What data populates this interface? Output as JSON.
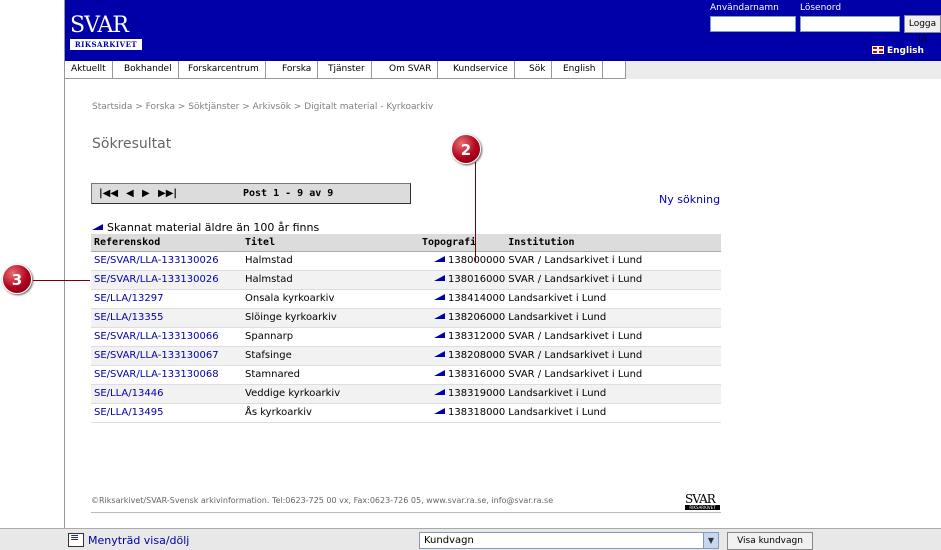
{
  "header": {
    "logo_text": "SVAR",
    "logo_sub": "RIKSARKIVET",
    "username_label": "Användarnamn",
    "password_label": "Lösenord",
    "username_value": "",
    "password_value": "",
    "login_button": "Logga in",
    "english_link": "English",
    "brand_color": "#0000a8"
  },
  "nav": {
    "items": [
      {
        "label": "Aktuellt"
      },
      {
        "label": "Bokhandel"
      },
      {
        "label": "Forskarcentrum"
      },
      {
        "label": "Forska"
      },
      {
        "label": "Tjänster"
      },
      {
        "label": "Om SVAR"
      },
      {
        "label": "Kundservice"
      },
      {
        "label": "Sök"
      },
      {
        "label": "English"
      }
    ]
  },
  "breadcrumb": "Startsida > Forska > Söktjänster > Arkivsök > Digitalt material - Kyrkoarkiv",
  "page_title": "Sökresultat",
  "pager": {
    "first_icon": "first-page-icon",
    "prev_icon": "prev-page-icon",
    "next_icon": "next-page-icon",
    "last_icon": "last-page-icon",
    "status": "Post 1 - 9 av 9"
  },
  "new_search": "Ny sökning",
  "legend": "Skannat material äldre än 100 år finns",
  "table": {
    "headers": [
      "Referenskod",
      "Titel",
      "Topografi",
      "Institution"
    ],
    "rows": [
      {
        "ref": "SE/SVAR/LLA-133130026",
        "title": "Halmstad",
        "topo": "138000000",
        "inst": "SVAR / Landsarkivet i Lund"
      },
      {
        "ref": "SE/SVAR/LLA-133130026",
        "title": "Halmstad",
        "topo": "138016000",
        "inst": "SVAR / Landsarkivet i Lund"
      },
      {
        "ref": "SE/LLA/13297",
        "title": "Onsala kyrkoarkiv",
        "topo": "138414000",
        "inst": "Landsarkivet i Lund"
      },
      {
        "ref": "SE/LLA/13355",
        "title": "Slöinge kyrkoarkiv",
        "topo": "138206000",
        "inst": "Landsarkivet i Lund"
      },
      {
        "ref": "SE/SVAR/LLA-133130066",
        "title": "Spannarp",
        "topo": "138312000",
        "inst": "SVAR / Landsarkivet i Lund"
      },
      {
        "ref": "SE/SVAR/LLA-133130067",
        "title": "Stafsinge",
        "topo": "138208000",
        "inst": "SVAR / Landsarkivet i Lund"
      },
      {
        "ref": "SE/SVAR/LLA-133130068",
        "title": "Stamnared",
        "topo": "138316000",
        "inst": "SVAR / Landsarkivet i Lund"
      },
      {
        "ref": "SE/LLA/13446",
        "title": "Veddige kyrkoarkiv",
        "topo": "138319000",
        "inst": "Landsarkivet i Lund"
      },
      {
        "ref": "SE/LLA/13495",
        "title": "Ås kyrkoarkiv",
        "topo": "138318000",
        "inst": "Landsarkivet i Lund"
      }
    ]
  },
  "callouts": {
    "two": "2",
    "three": "3"
  },
  "footer": {
    "text": "©Riksarkivet/SVAR-Svensk arkivinformation. Tel:0623-725 00 vx, Fax:0623-726 05, www.svar.ra.se, info@svar.ra.se",
    "logo_text": "SVAR",
    "logo_sub": "RIKSARKIVET"
  },
  "bottombar": {
    "menu_toggle": "Menyträd visa/dölj",
    "cart_select_value": "Kundvagn",
    "show_cart_button": "Visa kundvagn"
  }
}
